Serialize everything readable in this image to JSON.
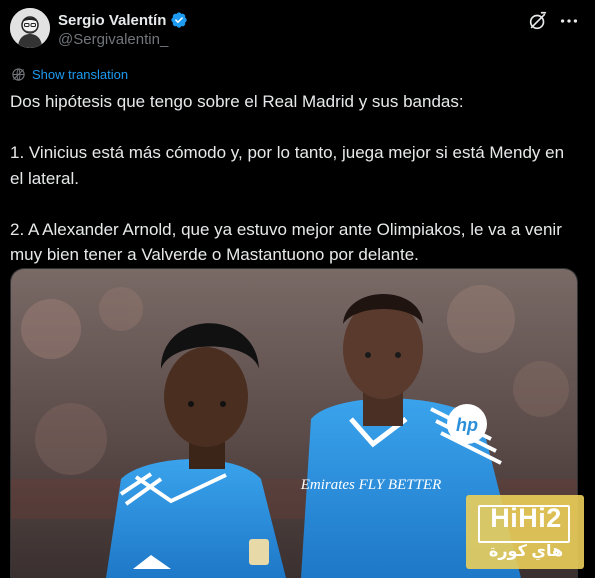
{
  "tweet": {
    "author": {
      "display_name": "Sergio Valentín",
      "handle": "@Sergivalentin_",
      "verified": true,
      "verified_color": "#1d9bf0"
    },
    "actions": {
      "grok_icon": "grok-icon",
      "more_icon": "more-dots-icon"
    },
    "translate_label": "Show translation",
    "paragraphs": [
      "Dos hipótesis que tengo sobre el Real Madrid y sus bandas:",
      "1. Vinicius está más cómodo y, por lo tanto, juega mejor si está Mendy en el lateral.",
      "2. A Alexander Arnold, que ya estuvo mejor ante Olimpiakos, le va a venir muy bien tener a Valverde o Mastantuono por delante."
    ],
    "media": {
      "jersey_sponsor": "hp",
      "jersey_text": "Emirates FLY BETTER",
      "watermark": {
        "line1": "HiHi2",
        "line2": "هاي كورة"
      }
    }
  },
  "colors": {
    "background": "#000000",
    "text": "#e7e9ea",
    "secondary_text": "#71767b",
    "link": "#1d9bf0",
    "jersey_blue": "#2a8fd8",
    "watermark_gold": "#ebce5a"
  }
}
